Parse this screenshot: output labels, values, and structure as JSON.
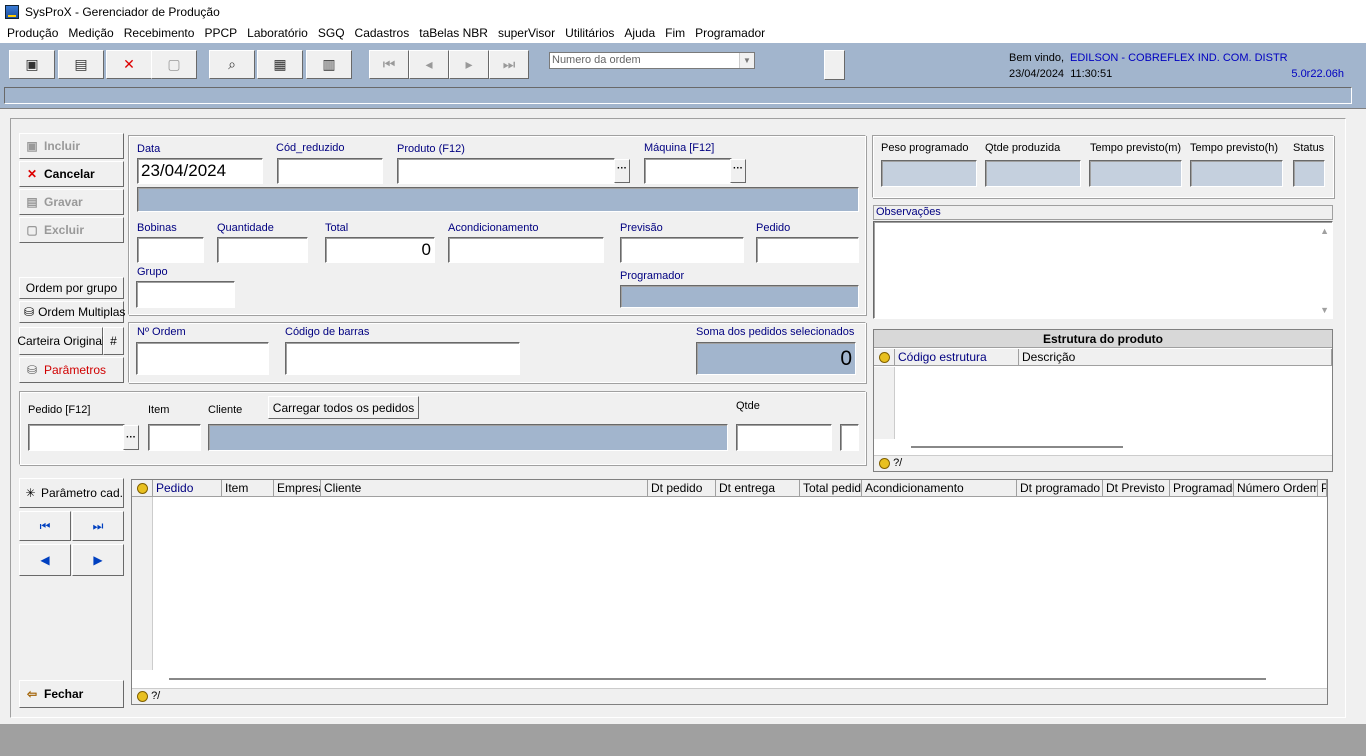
{
  "window": {
    "title": "SysProX - Gerenciador de Produção"
  },
  "menu": [
    "Produção",
    "Medição",
    "Recebimento",
    "PPCP",
    "Laboratório",
    "SGQ",
    "Cadastros",
    "taBelas NBR",
    "superVisor",
    "Utilitários",
    "Ajuda",
    "Fim",
    "Programador"
  ],
  "toolbar": {
    "order_combo_placeholder": "Numero da ordem",
    "welcome_label": "Bem vindo,",
    "user_name": "EDILSON - COBREFLEX IND. COM. DISTR",
    "date": "23/04/2024",
    "time": "11:30:51",
    "version": "5.0r22.06h"
  },
  "actions": {
    "incluir": "Incluir",
    "cancelar": "Cancelar",
    "gravar": "Gravar",
    "excluir": "Excluir",
    "ordem_por_grupo": "Ordem por grupo",
    "ordem_multiplas": "Ordem Multiplas",
    "carteira_original": "Carteira Original",
    "hash": "#",
    "parametros": "Parâmetros",
    "parametro_cad": "Parâmetro cad.",
    "fechar": "Fechar"
  },
  "form": {
    "data_label": "Data",
    "data_value": "23/04/2024",
    "cod_reduzido_label": "Cód_reduzido",
    "produto_label": "Produto (F12)",
    "maquina_label": "Máquina [F12]",
    "bobinas_label": "Bobinas",
    "quantidade_label": "Quantidade",
    "total_label": "Total",
    "total_value": "0",
    "acondicionamento_label": "Acondicionamento",
    "previsao_label": "Previsão",
    "pedido_label": "Pedido",
    "grupo_label": "Grupo",
    "programador_label": "Programador",
    "n_ordem_label": "Nº Ordem",
    "codigo_barras_label": "Código de barras",
    "soma_pedidos_label": "Soma dos pedidos selecionados",
    "soma_pedidos_value": "0"
  },
  "pedido_panel": {
    "pedido_label": "Pedido [F12]",
    "item_label": "Item",
    "cliente_label": "Cliente",
    "carregar_button": "Carregar todos os pedidos",
    "qtde_label": "Qtde"
  },
  "stats": {
    "peso_programado": "Peso programado",
    "qtde_produzida": "Qtde produzida",
    "tempo_previsto_m": "Tempo previsto(m)",
    "tempo_previsto_h": "Tempo previsto(h)",
    "status": "Status",
    "observacoes": "Observações"
  },
  "estrutura": {
    "title": "Estrutura do produto",
    "columns": [
      "Código estrutura",
      "Descrição"
    ],
    "footer": "?/"
  },
  "orders_grid": {
    "columns": [
      "Pedido",
      "Item",
      "Empresa",
      "Cliente",
      "Dt pedido",
      "Dt entrega",
      "Total pedido",
      "Acondicionamento",
      "Dt programado",
      "Dt Previsto",
      "Programado",
      "Número Ordem",
      "P"
    ],
    "footer": "?/"
  }
}
